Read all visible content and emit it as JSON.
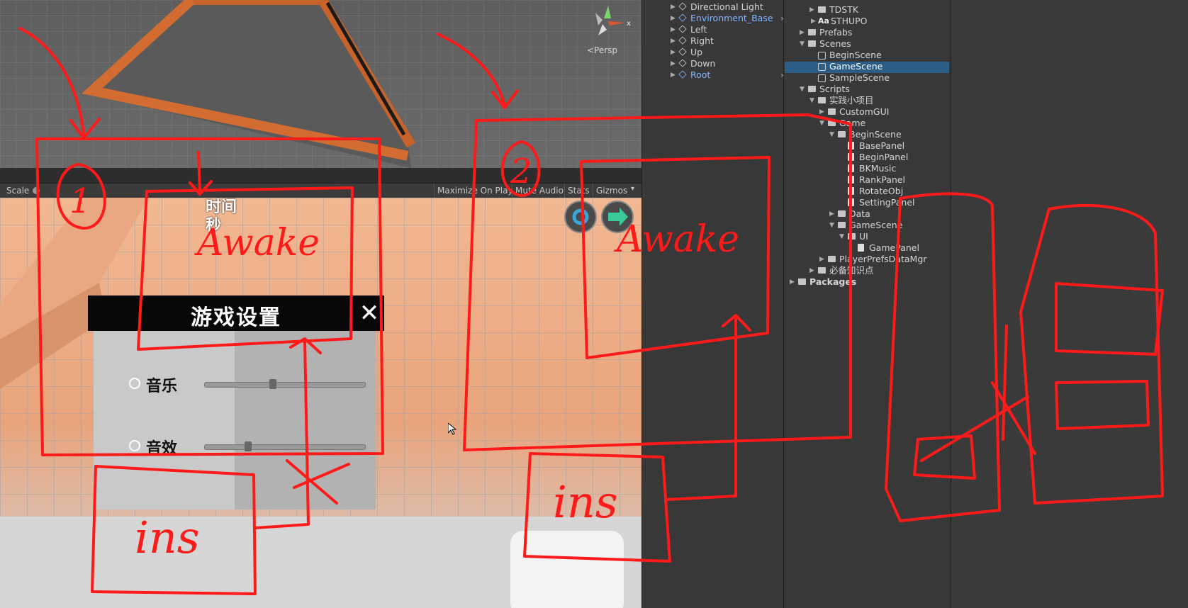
{
  "scene_view": {
    "persp_label": "<Persp"
  },
  "game_toolbar": {
    "scale_label": "Scale",
    "buttons": [
      "Maximize On Play",
      "Mute Audio",
      "Stats",
      "Gizmos"
    ]
  },
  "game_view": {
    "timer_label_line1": "时间",
    "timer_label_line2": "秒",
    "settings_panel": {
      "title": "游戏设置",
      "close_glyph": "✕",
      "rows": [
        {
          "label": "音乐",
          "value": 0.42
        },
        {
          "label": "音效",
          "value": 0.26
        }
      ]
    }
  },
  "hierarchy": {
    "items": [
      "Directional Light",
      "Environment_Base",
      "Left",
      "Right",
      "Up",
      "Down",
      "Root"
    ]
  },
  "project": {
    "items": [
      {
        "label": "TDSTK",
        "type": "folder"
      },
      {
        "label": "STHUPO",
        "type": "font"
      },
      {
        "label": "Prefabs",
        "type": "folder"
      },
      {
        "label": "Scenes",
        "type": "folder"
      },
      {
        "label": "BeginScene",
        "type": "scene"
      },
      {
        "label": "GameScene",
        "type": "scene",
        "selected": true
      },
      {
        "label": "SampleScene",
        "type": "scene"
      },
      {
        "label": "Scripts",
        "type": "folder"
      },
      {
        "label": "实践小项目",
        "type": "folder"
      },
      {
        "label": "CustomGUI",
        "type": "folder"
      },
      {
        "label": "Game",
        "type": "folder"
      },
      {
        "label": "BeginScene",
        "type": "folder"
      },
      {
        "label": "BasePanel",
        "type": "script"
      },
      {
        "label": "BeginPanel",
        "type": "script"
      },
      {
        "label": "BKMusic",
        "type": "script"
      },
      {
        "label": "RankPanel",
        "type": "script"
      },
      {
        "label": "RotateObj",
        "type": "script"
      },
      {
        "label": "SettingPanel",
        "type": "script"
      },
      {
        "label": "Data",
        "type": "folder"
      },
      {
        "label": "GameScene",
        "type": "folder"
      },
      {
        "label": "UI",
        "type": "folder"
      },
      {
        "label": "GamePanel",
        "type": "script"
      },
      {
        "label": "PlayerPrefsDataMgr",
        "type": "folder"
      },
      {
        "label": "必备知识点",
        "type": "folder"
      },
      {
        "label": "Packages",
        "type": "folder"
      }
    ]
  },
  "annotations": {
    "circle_1": "1",
    "circle_2": "2",
    "awake_1": "Awake",
    "awake_2": "Awake",
    "ins_1": "ins",
    "ins_2": "ins",
    "color": "#ff1a1a"
  },
  "colors": {
    "selection": "#2c5d87",
    "panel_bg": "#383838",
    "prefab_blue": "#7fb6ff"
  }
}
